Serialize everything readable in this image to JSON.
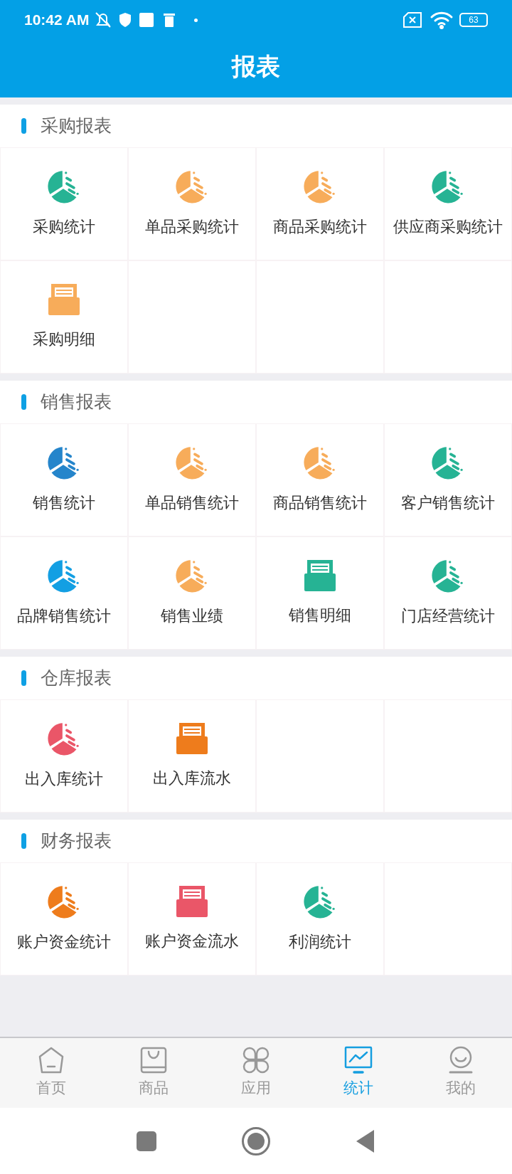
{
  "status_bar": {
    "time": "10:42 AM",
    "battery": "63"
  },
  "title": "报表",
  "sections": [
    {
      "title": "采购报表",
      "items": [
        {
          "label": "采购统计",
          "kind": "pie",
          "color": "#26b394"
        },
        {
          "label": "单品采购统计",
          "kind": "pie",
          "color": "#f7ac5a"
        },
        {
          "label": "商品采购统计",
          "kind": "pie",
          "color": "#f7ac5a"
        },
        {
          "label": "供应商采购统计",
          "kind": "pie",
          "color": "#26b394"
        },
        {
          "label": "采购明细",
          "kind": "ledger",
          "color": "#f7ac5a"
        }
      ]
    },
    {
      "title": "销售报表",
      "items": [
        {
          "label": "销售统计",
          "kind": "pie",
          "color": "#2585cb"
        },
        {
          "label": "单品销售统计",
          "kind": "pie",
          "color": "#f7ac5a"
        },
        {
          "label": "商品销售统计",
          "kind": "pie",
          "color": "#f7ac5a"
        },
        {
          "label": "客户销售统计",
          "kind": "pie",
          "color": "#26b394"
        },
        {
          "label": "品牌销售统计",
          "kind": "pie",
          "color": "#139fe3"
        },
        {
          "label": "销售业绩",
          "kind": "pie",
          "color": "#f7ac5a"
        },
        {
          "label": "销售明细",
          "kind": "ledger",
          "color": "#26b394"
        },
        {
          "label": "门店经营统计",
          "kind": "pie",
          "color": "#26b394"
        }
      ]
    },
    {
      "title": "仓库报表",
      "items": [
        {
          "label": "出入库统计",
          "kind": "pie",
          "color": "#ea5668"
        },
        {
          "label": "出入库流水",
          "kind": "ledger",
          "color": "#ee7c1c"
        }
      ]
    },
    {
      "title": "财务报表",
      "items": [
        {
          "label": "账户资金统计",
          "kind": "pie",
          "color": "#ee7c1c"
        },
        {
          "label": "账户资金流水",
          "kind": "ledger",
          "color": "#ea5668"
        },
        {
          "label": "利润统计",
          "kind": "pie",
          "color": "#26b394"
        }
      ]
    }
  ],
  "tabs": [
    {
      "label": "首页",
      "kind": "home",
      "selected": false
    },
    {
      "label": "商品",
      "kind": "bag",
      "selected": false
    },
    {
      "label": "应用",
      "kind": "apps",
      "selected": false
    },
    {
      "label": "统计",
      "kind": "chart",
      "selected": true
    },
    {
      "label": "我的",
      "kind": "user",
      "selected": false
    }
  ]
}
